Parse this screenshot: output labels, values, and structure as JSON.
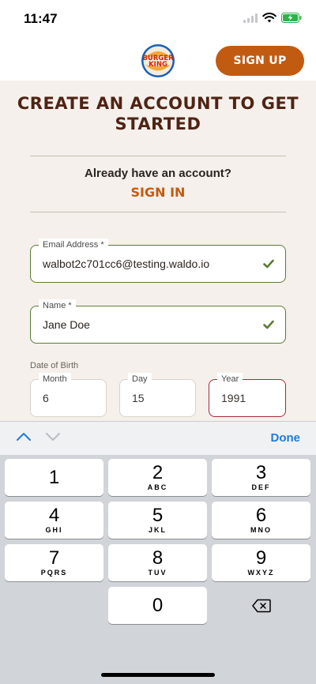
{
  "status_bar": {
    "time": "11:47"
  },
  "header": {
    "logo_text_top": "BURGER",
    "logo_text_bottom": "KING",
    "signup_label": "SIGN UP"
  },
  "main": {
    "title_line1": "CREATE AN ACCOUNT TO GET",
    "title_line2": "STARTED",
    "signin_prompt": "Already have an account?",
    "signin_label": "SIGN IN",
    "email": {
      "label": "Email Address *",
      "value": "walbot2c701cc6@testing.waldo.io"
    },
    "name": {
      "label": "Name *",
      "value": "Jane Doe"
    },
    "dob": {
      "label": "Date of Birth",
      "month": {
        "label": "Month",
        "value": "6"
      },
      "day": {
        "label": "Day",
        "value": "15"
      },
      "year": {
        "label": "Year",
        "value": "1991"
      }
    }
  },
  "keyboard": {
    "done_label": "Done",
    "keys": [
      {
        "digit": "1",
        "letters": ""
      },
      {
        "digit": "2",
        "letters": "ABC"
      },
      {
        "digit": "3",
        "letters": "DEF"
      },
      {
        "digit": "4",
        "letters": "GHI"
      },
      {
        "digit": "5",
        "letters": "JKL"
      },
      {
        "digit": "6",
        "letters": "MNO"
      },
      {
        "digit": "7",
        "letters": "PQRS"
      },
      {
        "digit": "8",
        "letters": "TUV"
      },
      {
        "digit": "9",
        "letters": "WXYZ"
      },
      {
        "digit": "0",
        "letters": ""
      }
    ]
  },
  "colors": {
    "brand_orange": "#c25b12",
    "brand_brown": "#502314",
    "valid_green": "#5c7d33",
    "focus_red": "#a52a3a",
    "link_blue": "#1f7bd9"
  },
  "icons": [
    "wifi-icon",
    "battery-icon",
    "check-icon",
    "chevron-up-icon",
    "chevron-down-icon",
    "backspace-icon"
  ]
}
